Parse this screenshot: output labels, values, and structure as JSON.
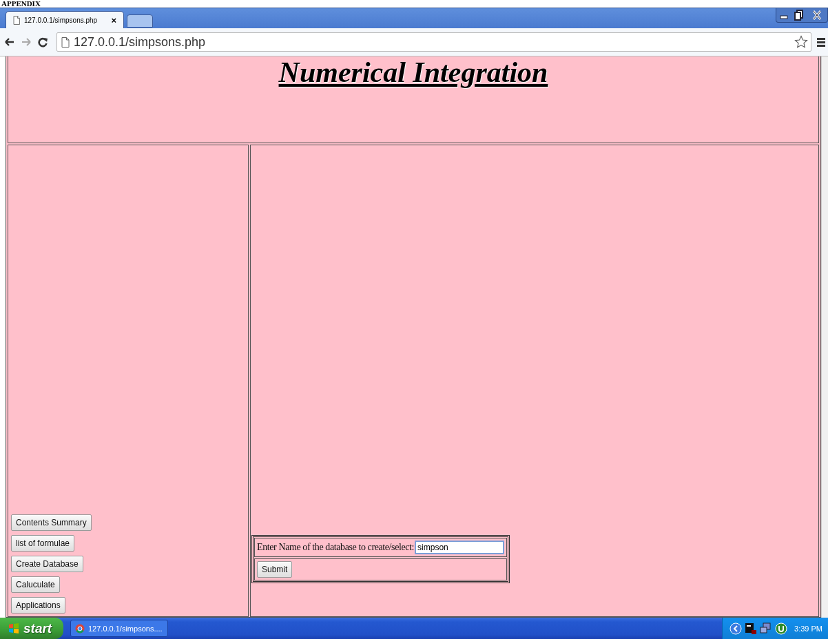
{
  "appendix_heading": "APPENDIX",
  "browser": {
    "tabs": [
      {
        "title": "127.0.0.1/simpsons.php",
        "close": "×",
        "selected": true
      }
    ],
    "address": "127.0.0.1/simpsons.php"
  },
  "page": {
    "title": "Numerical Integration",
    "nav_buttons": [
      "Contents Summary",
      "list of formulae",
      "Create Database",
      "Caluculate",
      "Applications"
    ],
    "form": {
      "label": "Enter Name of the database to create/select:",
      "input_value": "simpson",
      "submit": "Submit"
    }
  },
  "taskbar": {
    "start": "start",
    "tasks": [
      {
        "label": "127.0.0.1/simpsons....",
        "selected": false
      }
    ],
    "clock": "3:39 PM"
  }
}
